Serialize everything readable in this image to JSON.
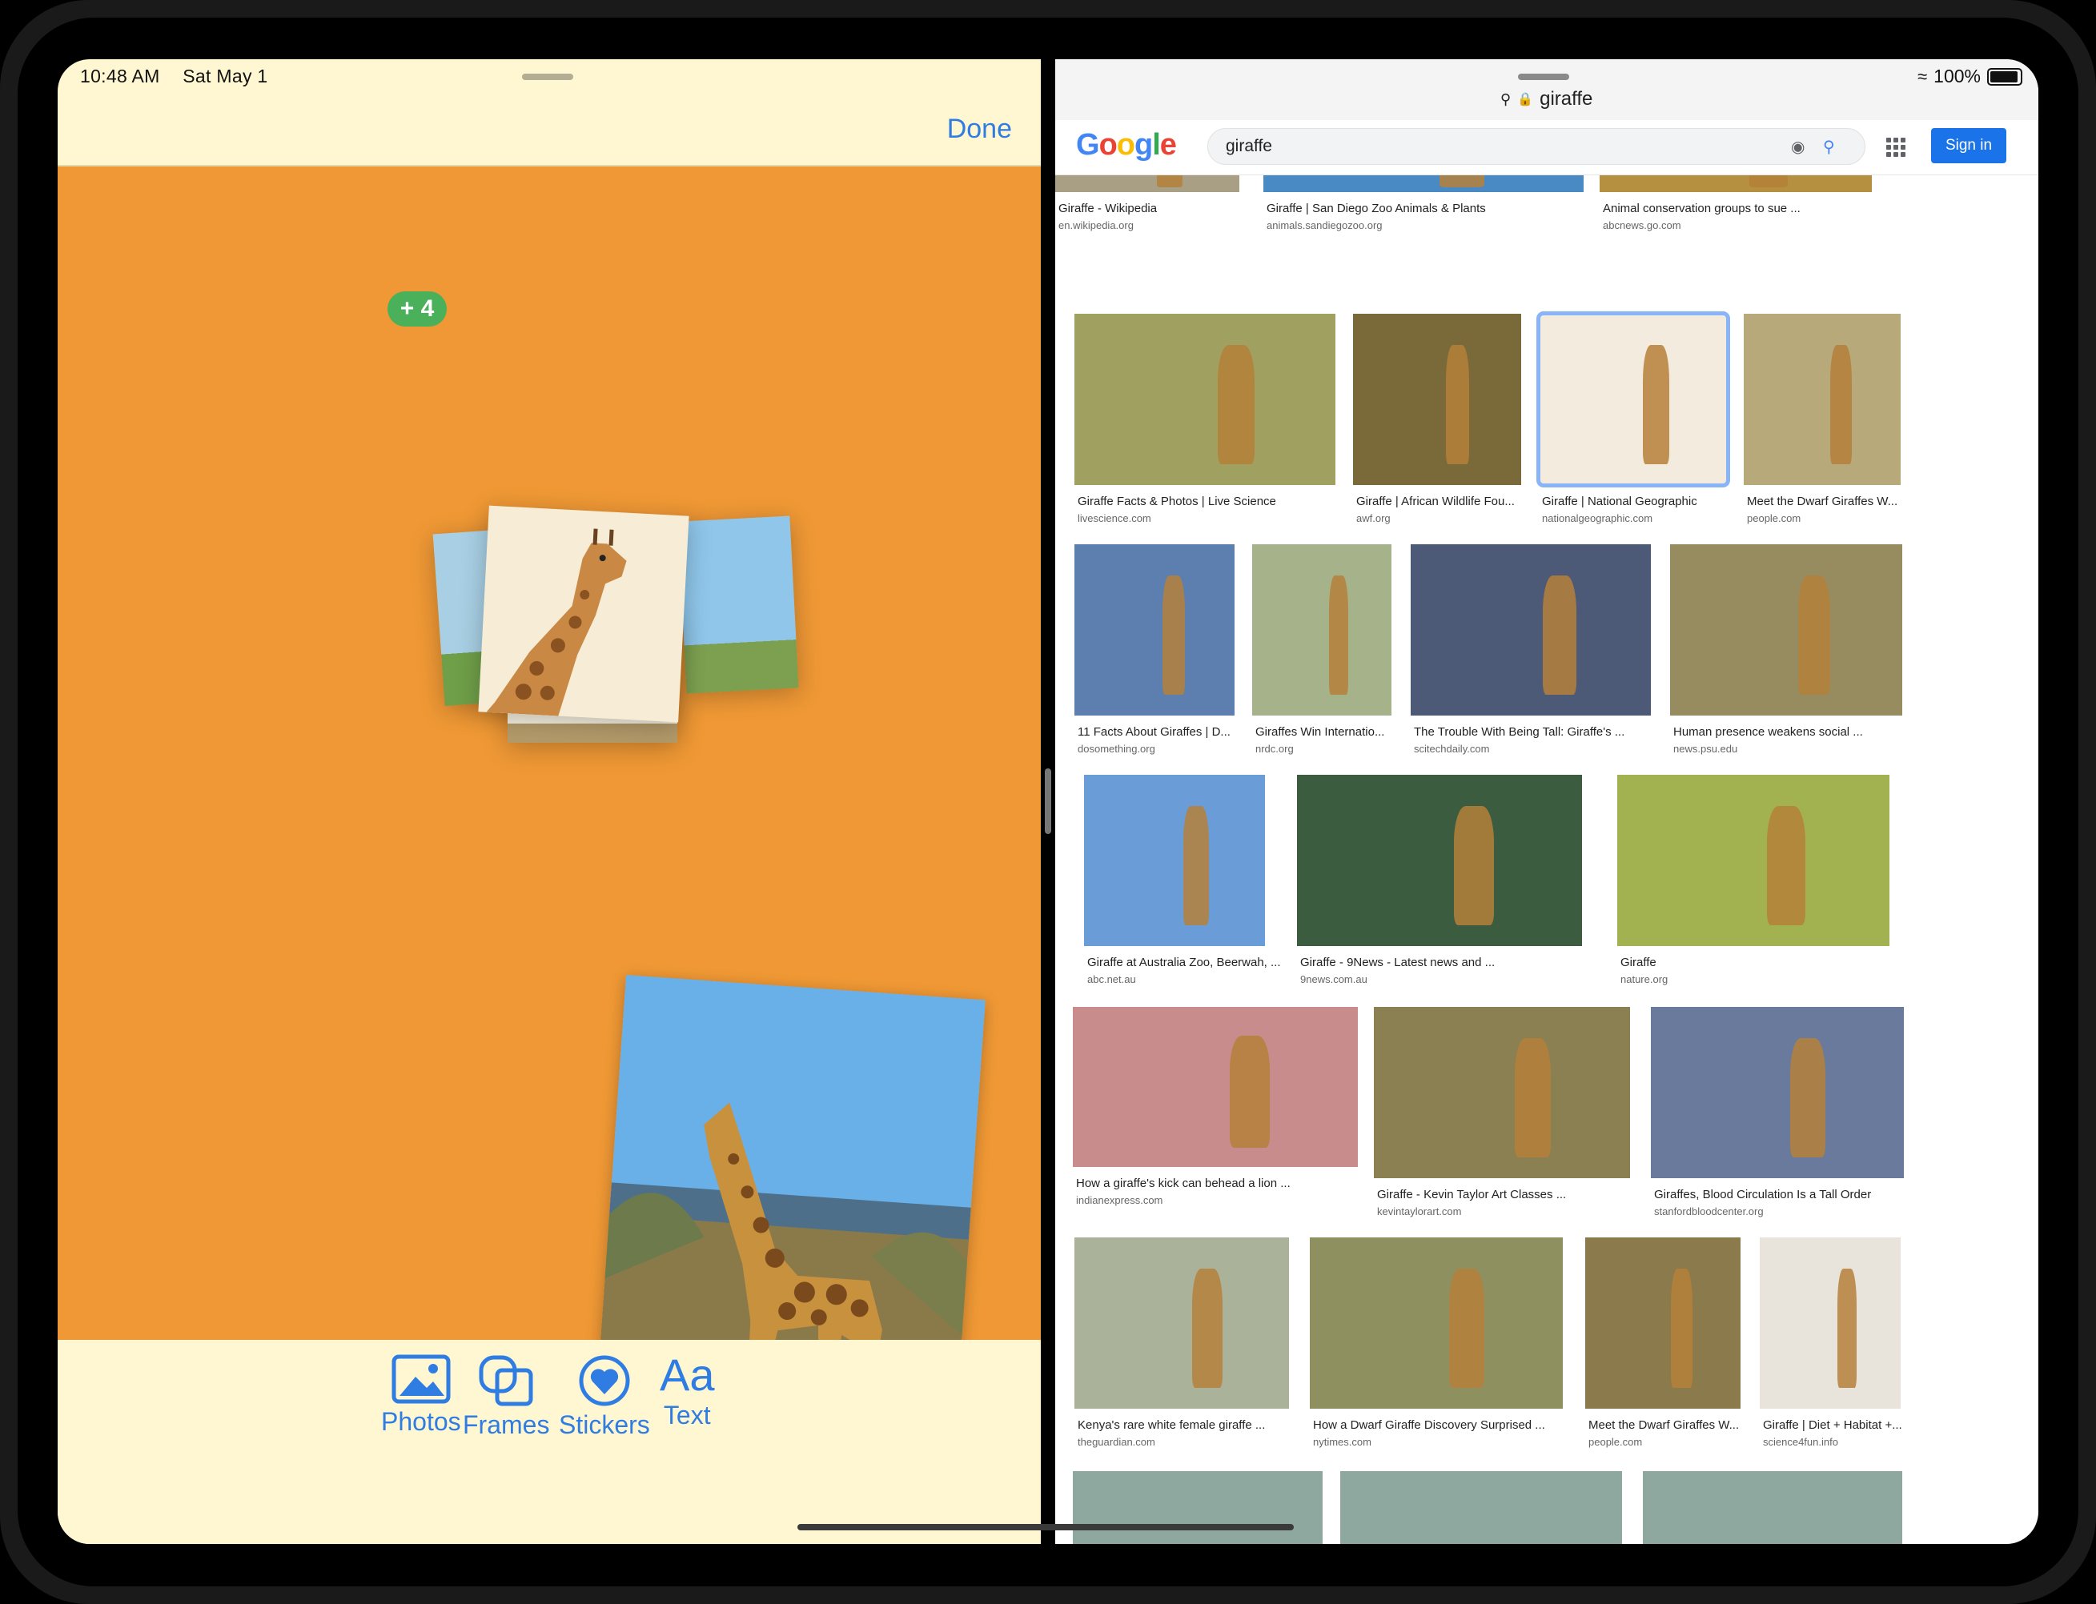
{
  "left": {
    "time": "10:48 AM",
    "date": "Sat May 1",
    "done_label": "Done",
    "badge": "+ 4",
    "tools": [
      {
        "label": "Photos",
        "icon": "photo-icon"
      },
      {
        "label": "Frames",
        "icon": "frames-icon"
      },
      {
        "label": "Stickers",
        "icon": "heart-sticker-icon"
      },
      {
        "label": "Text",
        "icon": "text-aa-icon"
      }
    ],
    "text_icon_glyph": "Aa"
  },
  "right": {
    "battery": "100%",
    "url": "giraffe",
    "logo": "Google",
    "search_value": "giraffe",
    "signin_label": "Sign in",
    "results": [
      {
        "title": "Giraffe - Wikipedia",
        "site": "en.wikipedia.org"
      },
      {
        "title": "Giraffe | San Diego Zoo Animals & Plants",
        "site": "animals.sandiegozoo.org"
      },
      {
        "title": "Animal conservation groups to sue ...",
        "site": "abcnews.go.com"
      },
      {
        "title": "Giraffe Facts & Photos | Live Science",
        "site": "livescience.com"
      },
      {
        "title": "Giraffe | African Wildlife Fou...",
        "site": "awf.org"
      },
      {
        "title": "Giraffe | National Geographic",
        "site": "nationalgeographic.com"
      },
      {
        "title": "Meet the Dwarf Giraffes W...",
        "site": "people.com"
      },
      {
        "title": "11 Facts About Giraffes | D...",
        "site": "dosomething.org"
      },
      {
        "title": "Giraffes Win Internatio...",
        "site": "nrdc.org"
      },
      {
        "title": "The Trouble With Being Tall: Giraffe's ...",
        "site": "scitechdaily.com"
      },
      {
        "title": "Human presence weakens social ...",
        "site": "news.psu.edu"
      },
      {
        "title": "Giraffe at Australia Zoo, Beerwah, ...",
        "site": "abc.net.au"
      },
      {
        "title": "Giraffe - 9News - Latest news and ...",
        "site": "9news.com.au"
      },
      {
        "title": "Giraffe",
        "site": "nature.org"
      },
      {
        "title": "How a giraffe's kick can behead a lion ...",
        "site": "indianexpress.com"
      },
      {
        "title": "Giraffe - Kevin Taylor Art Classes ...",
        "site": "kevintaylorart.com"
      },
      {
        "title": "Giraffes, Blood Circulation Is a Tall Order",
        "site": "stanfordbloodcenter.org"
      },
      {
        "title": "Kenya's rare white female giraffe ...",
        "site": "theguardian.com"
      },
      {
        "title": "How a Dwarf Giraffe Discovery Surprised ...",
        "site": "nytimes.com"
      },
      {
        "title": "Meet the Dwarf Giraffes W...",
        "site": "people.com"
      },
      {
        "title": "Giraffe | Diet + Habitat +...",
        "site": "science4fun.info"
      }
    ]
  },
  "colors": {
    "canvas": "#ef9835",
    "toolbar_bg": "#fff7d1",
    "accent_blue": "#2f7de2",
    "badge_green": "#4ab05a",
    "google_blue": "#1a73e8"
  }
}
